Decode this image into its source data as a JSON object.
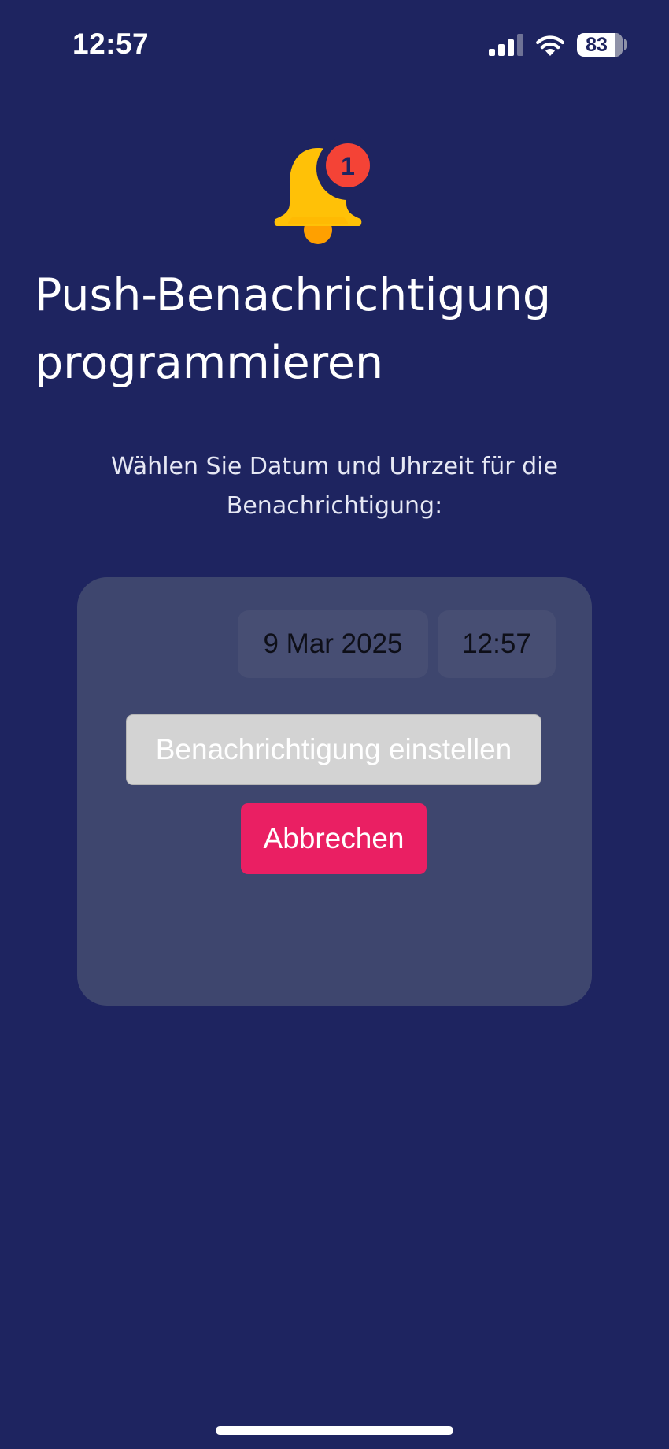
{
  "status_bar": {
    "time": "12:57",
    "battery_level": "83",
    "battery_fraction": 0.83,
    "signal_bars_active": 3,
    "icons": [
      "cellular-signal-icon",
      "wifi-icon",
      "battery-icon"
    ]
  },
  "header": {
    "icon": "notification-bell-icon",
    "badge_count": "1",
    "title": "Push-Benachrichtigung programmieren",
    "instruction": "Wählen Sie Datum und Uhrzeit für die Benachrichtigung:"
  },
  "picker": {
    "date_value": "9 Mar 2025",
    "time_value": "12:57"
  },
  "actions": {
    "set_label": "Benachrichtigung einstellen",
    "cancel_label": "Abbrechen"
  },
  "colors": {
    "background": "#1e2460",
    "card": "#3e466e",
    "set_button": "#d3d3d3",
    "cancel_button": "#ea1f63",
    "bell": "#ffc107",
    "badge": "#f44336"
  }
}
